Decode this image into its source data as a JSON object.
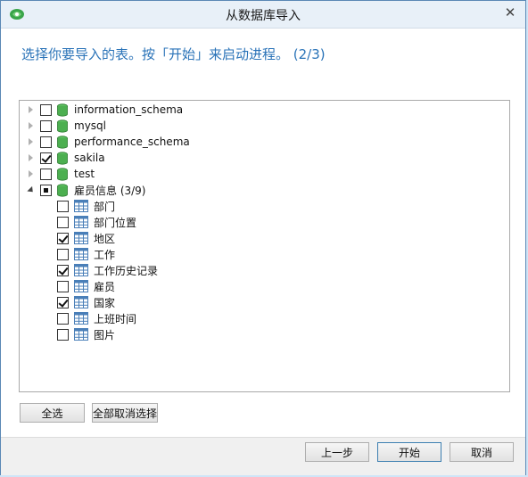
{
  "window": {
    "title": "从数据库导入"
  },
  "instruction": "选择你要导入的表。按「开始」来启动进程。 (2/3)",
  "tree": {
    "databases": [
      {
        "name": "information_schema",
        "checked": "unchecked",
        "expanded": false
      },
      {
        "name": "mysql",
        "checked": "unchecked",
        "expanded": false
      },
      {
        "name": "performance_schema",
        "checked": "unchecked",
        "expanded": false
      },
      {
        "name": "sakila",
        "checked": "checked",
        "expanded": false
      },
      {
        "name": "test",
        "checked": "unchecked",
        "expanded": false
      },
      {
        "name": "雇员信息 (3/9)",
        "checked": "partial",
        "expanded": true
      }
    ],
    "tables": [
      {
        "name": "部门",
        "checked": false
      },
      {
        "name": "部门位置",
        "checked": false
      },
      {
        "name": "地区",
        "checked": true
      },
      {
        "name": "工作",
        "checked": false
      },
      {
        "name": "工作历史记录",
        "checked": true
      },
      {
        "name": "雇员",
        "checked": false
      },
      {
        "name": "国家",
        "checked": true
      },
      {
        "name": "上班时间",
        "checked": false
      },
      {
        "name": "图片",
        "checked": false
      }
    ]
  },
  "buttons": {
    "select_all": "全选",
    "deselect_all": "全部取消选择",
    "back": "上一步",
    "start": "开始",
    "cancel": "取消"
  },
  "colors": {
    "instruction": "#2a73b8",
    "db_icon": "#4caf50",
    "table_icon": "#4a7fb8"
  },
  "icons": {
    "app": "navicat-icon",
    "database": "database-icon",
    "table": "table-icon",
    "close": "close-icon"
  }
}
